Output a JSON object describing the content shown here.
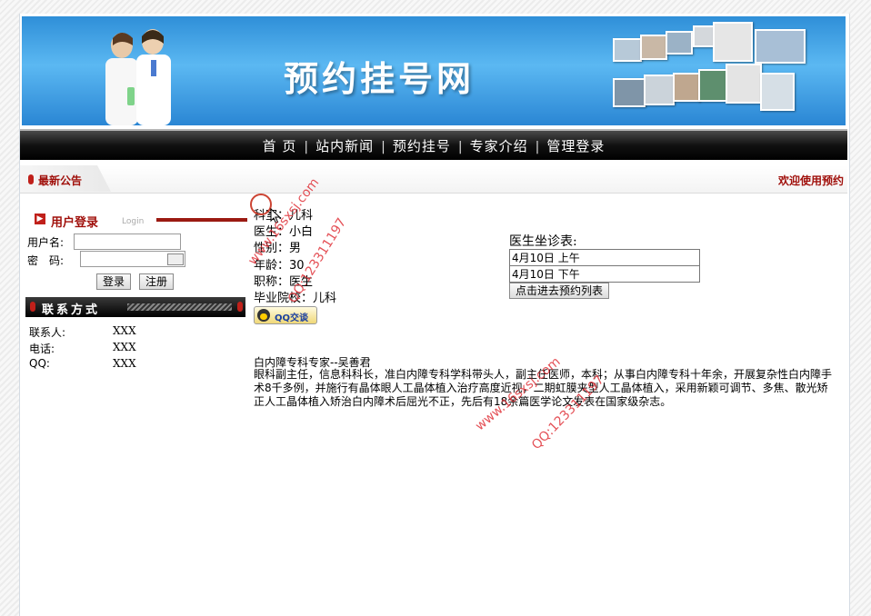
{
  "banner": {
    "title": "预约挂号网"
  },
  "nav": {
    "items": [
      "首 页",
      "站内新闻",
      "预约挂号",
      "专家介绍",
      "管理登录"
    ],
    "separator": "|"
  },
  "notice": {
    "label": "最新公告",
    "marquee_text": "欢迎使用预约"
  },
  "login": {
    "title": "用户登录",
    "subtitle": "Login",
    "username_label": "用户名:",
    "password_label": "密　码:",
    "username_value": "",
    "password_value": "",
    "login_button": "登录",
    "register_button": "注册"
  },
  "contact": {
    "title": "联系方式",
    "rows": [
      {
        "label": "联系人:",
        "value": "XXX"
      },
      {
        "label": "电话:",
        "value": "XXX"
      },
      {
        "label": "QQ:",
        "value": "XXX"
      }
    ]
  },
  "doctor": {
    "lines": [
      "科室：儿科",
      "医生：小白",
      "性别：男",
      "年龄：30",
      "职称：医生",
      "毕业院校：儿科"
    ],
    "qq_button": "QQ交谈"
  },
  "schedule": {
    "title": "医生坐诊表:",
    "rows": [
      "4月10日 上午",
      "4月10日 下午"
    ],
    "action_button": "点击进去预约列表"
  },
  "description": {
    "title": "白内障专科专家--吴善君",
    "body": "眼科副主任，信息科科长，准白内障专科学科带头人，副主任医师，本科；从事白内障专科十年余，开展复杂性白内障手术8千多例，并施行有晶体眼人工晶体植入治疗高度近视，二期虹膜夹型人工晶体植入，采用新颖可调节、多焦、散光矫正人工晶体植入矫治白内障术后屈光不正，先后有18余篇医学论文发表在国家级杂志。"
  },
  "watermarks": [
    "www.16sxsj.com",
    "QQ:123311197",
    "www.16sxsj.com",
    "QQ:123311197"
  ],
  "colors": {
    "accent_red": "#a0100b",
    "banner_blue": "#2f8fd8",
    "nav_black": "#111111",
    "watermark_red": "#e0333a"
  }
}
